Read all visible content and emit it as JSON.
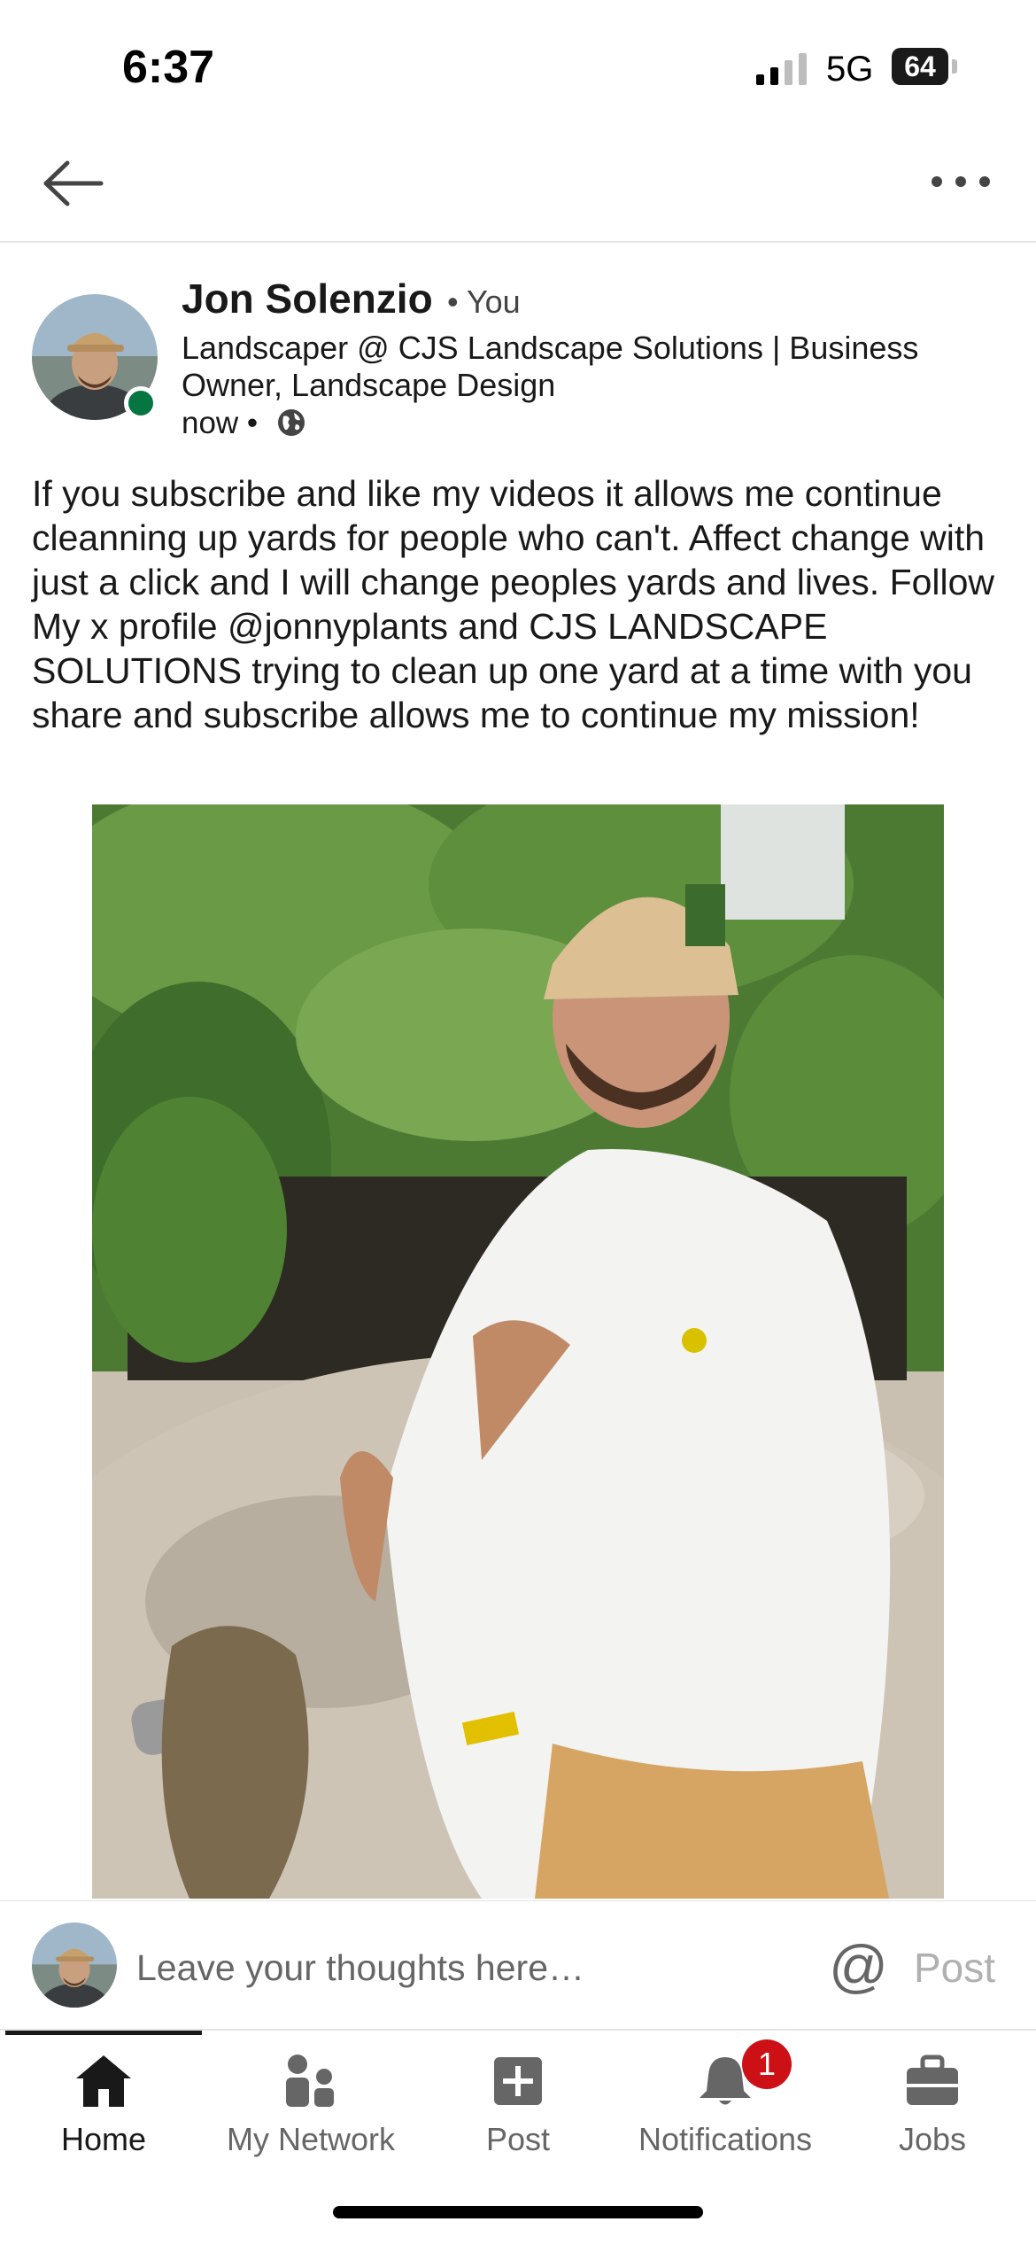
{
  "status_bar": {
    "time": "6:37",
    "network": "5G",
    "battery": "64"
  },
  "top_nav": {
    "back_icon": "arrow-left-icon",
    "more_icon": "more-horizontal-icon"
  },
  "post": {
    "author": {
      "name": "Jon Solenzio",
      "badge": "• You",
      "headline": "Landscaper @ CJS Landscape Solutions | Business Owner, Landscape Design",
      "timestamp": "now •",
      "online": true,
      "visibility_icon": "globe-icon"
    },
    "text": "If you subscribe and like my videos it allows me continue cleanning up yards for people who can't. Affect change with just a click and I will change peoples yards and lives. Follow My x profile @jonnyplants and CJS LANDSCAPE SOLUTIONS trying to clean up one yard at a time with you share and subscribe allows me to continue my mission!"
  },
  "comment_bar": {
    "placeholder": "Leave your thoughts here…",
    "mention_symbol": "@",
    "post_label": "Post"
  },
  "bottom_nav": {
    "items": [
      {
        "label": "Home",
        "icon": "home-icon",
        "active": true
      },
      {
        "label": "My Network",
        "icon": "network-icon",
        "active": false
      },
      {
        "label": "Post",
        "icon": "plus-square-icon",
        "active": false
      },
      {
        "label": "Notifications",
        "icon": "bell-icon",
        "active": false,
        "badge": "1"
      },
      {
        "label": "Jobs",
        "icon": "briefcase-icon",
        "active": false
      }
    ]
  },
  "colors": {
    "online": "#057642",
    "notification_badge": "#cc1016",
    "text_primary": "#191919",
    "text_secondary": "#666666"
  }
}
